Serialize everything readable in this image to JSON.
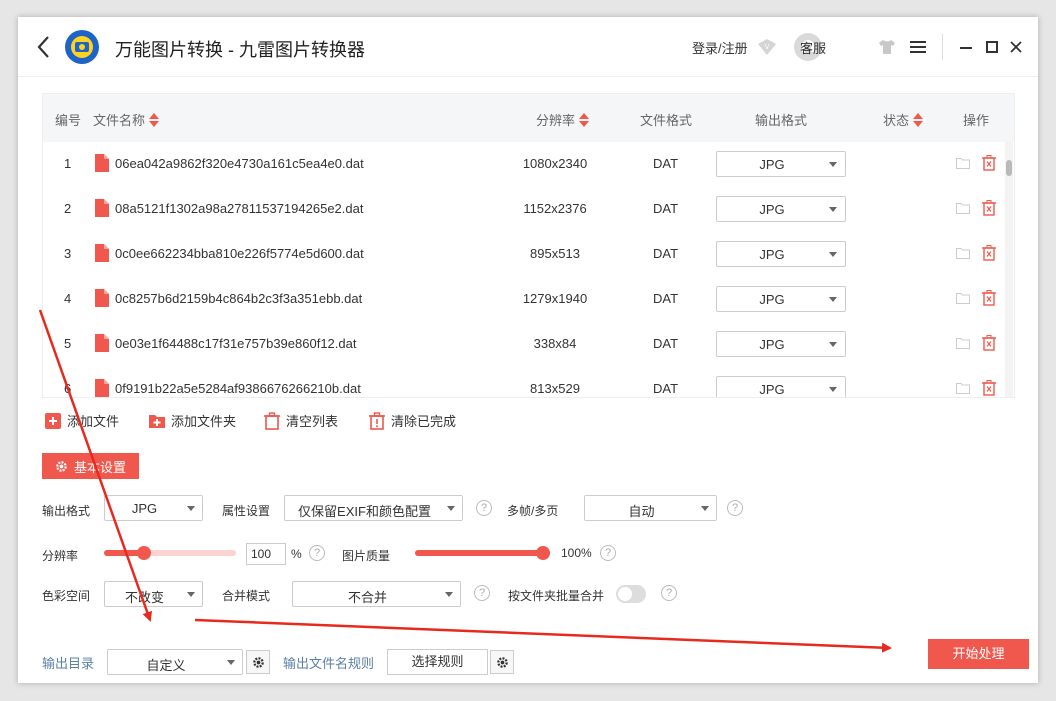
{
  "titlebar": {
    "title": "万能图片转换 - 九雷图片转换器",
    "login_label": "登录/注册",
    "service_label": "客服",
    "icons": [
      "back-arrow-icon",
      "app-logo-icon",
      "vip-icon",
      "headset-icon",
      "skin-icon",
      "menu-icon",
      "minimize-icon",
      "maximize-icon",
      "close-icon"
    ]
  },
  "table": {
    "headers": {
      "index": "编号",
      "filename": "文件名称",
      "resolution": "分辨率",
      "format": "文件格式",
      "output": "输出格式",
      "status": "状态",
      "action": "操作"
    },
    "rows": [
      {
        "index": "1",
        "name": "06ea042a9862f320e4730a161c5ea4e0.dat",
        "res": "1080x2340",
        "fmt": "DAT",
        "out": "JPG"
      },
      {
        "index": "2",
        "name": "08a5121f1302a98a27811537194265e2.dat",
        "res": "1152x2376",
        "fmt": "DAT",
        "out": "JPG"
      },
      {
        "index": "3",
        "name": "0c0ee662234bba810e226f5774e5d600.dat",
        "res": "895x513",
        "fmt": "DAT",
        "out": "JPG"
      },
      {
        "index": "4",
        "name": "0c8257b6d2159b4c864b2c3f3a351ebb.dat",
        "res": "1279x1940",
        "fmt": "DAT",
        "out": "JPG"
      },
      {
        "index": "5",
        "name": "0e03e1f64488c17f31e757b39e860f12.dat",
        "res": "338x84",
        "fmt": "DAT",
        "out": "JPG"
      },
      {
        "index": "6",
        "name": "0f9191b22a5e5284af9386676266210b.dat",
        "res": "813x529",
        "fmt": "DAT",
        "out": "JPG"
      }
    ]
  },
  "toolbar": {
    "add_file": "添加文件",
    "add_folder": "添加文件夹",
    "clear_list": "清空列表",
    "clear_done": "清除已完成"
  },
  "settings": {
    "section_label": "基本设置",
    "output_format_label": "输出格式",
    "output_format_value": "JPG",
    "attr_label": "属性设置",
    "attr_value": "仅保留EXIF和颜色配置",
    "multiframe_label": "多帧/多页",
    "multiframe_value": "自动",
    "resolution_label": "分辨率",
    "resolution_value": "100",
    "resolution_unit": "%",
    "resolution_level": 0.3,
    "quality_label": "图片质量",
    "quality_value": "100%",
    "quality_level": 1.0,
    "colorspace_label": "色彩空间",
    "colorspace_value": "不改变",
    "merge_label": "合并模式",
    "merge_value": "不合并",
    "batch_merge_label": "按文件夹批量合并",
    "batch_merge_on": false
  },
  "footer": {
    "output_dir_label": "输出目录",
    "output_dir_value": "自定义",
    "filename_rule_label": "输出文件名规则",
    "choose_rule": "选择规则",
    "start": "开始处理"
  },
  "colors": {
    "accent": "#f0584d",
    "annotation": "#e8291e"
  }
}
